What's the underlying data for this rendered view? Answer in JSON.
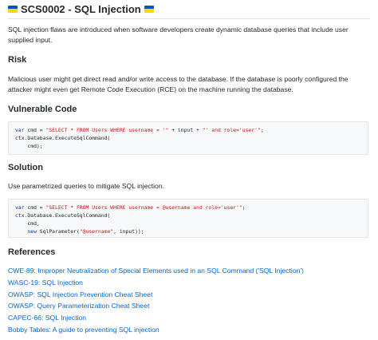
{
  "title": "SCS0002 - SQL Injection",
  "intro": "SQL injection flaws are introduced when software developers create dynamic database queries that include user supplied input.",
  "risk": {
    "heading": "Risk",
    "text": "Malicious user might get direct read and/or write access to the database. If the database is poorly configured the attacker might even get Remote Code Execution (RCE) on the machine running the database."
  },
  "vulnerable": {
    "heading": "Vulnerable Code",
    "code": {
      "l1_kw": "var",
      "l1_a": " cmd = ",
      "l1_str1": "\"SELECT * FROM Users WHERE username = '\"",
      "l1_b": " + input + ",
      "l1_str2": "\"' and role='user'\"",
      "l1_c": ";",
      "l2": "ctx.Database.ExecuteSqlCommand(",
      "l3": "    cmd);"
    }
  },
  "solution": {
    "heading": "Solution",
    "text": "Use parametrized queries to mitigate SQL injection.",
    "code": {
      "l1_kw": "var",
      "l1_a": " cmd = ",
      "l1_str": "\"SELECT * FROM Users WHERE username = @username and role='user'\"",
      "l1_c": ";",
      "l2": "ctx.Database.ExecuteSqlCommand(",
      "l3": "    cmd,",
      "l4_indent": "    ",
      "l4_kw": "new",
      "l4_a": " SqlParameter(",
      "l4_str": "\"@username\"",
      "l4_b": ", input));"
    }
  },
  "references": {
    "heading": "References",
    "links": [
      "CWE-89: Improper Neutralization of Special Elements used in an SQL Command ('SQL Injection')",
      "WASC-19: SQL Injection",
      "OWASP: SQL Injection Prevention Cheat Sheet",
      "OWASP: Query Parameterization Cheat Sheet",
      "CAPEC-66: SQL Injection",
      "Bobby Tables: A guide to preventing SQL injection"
    ]
  },
  "colors": {
    "flag_blue": "#0057b7",
    "flag_yellow": "#ffd700",
    "link": "#0366d6",
    "keyword": "#0033b3",
    "string": "#c41a16"
  },
  "icons": [
    "ukraine-flag-icon",
    "ukraine-flag-icon"
  ]
}
